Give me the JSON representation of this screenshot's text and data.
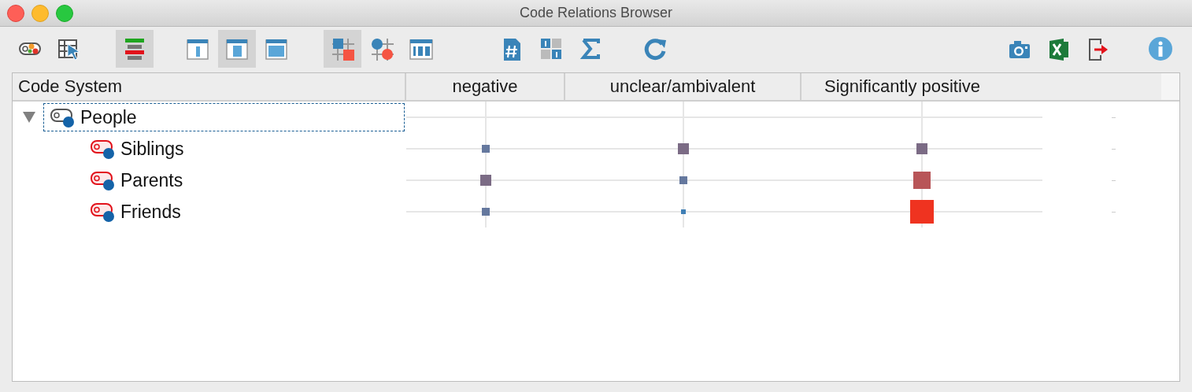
{
  "window": {
    "title": "Code Relations Browser"
  },
  "toolbar": [
    {
      "selected": false
    },
    {
      "selected": false
    },
    {
      "selected": true
    },
    {
      "selected": false
    },
    {
      "selected": true
    },
    {
      "selected": false
    },
    {
      "selected": true
    },
    {
      "selected": false
    },
    {
      "selected": false
    },
    {
      "selected": false
    },
    {
      "selected": false
    },
    {
      "selected": false
    },
    {
      "selected": false
    },
    {
      "selected": false
    },
    {
      "selected": false
    },
    {
      "selected": false
    },
    {
      "selected": false
    }
  ],
  "table": {
    "columns": [
      "Code System",
      "negative",
      "unclear/ambivalent",
      "Significantly positive"
    ],
    "tree": [
      {
        "name": "People",
        "kind": "group",
        "expanded": true,
        "focused": true,
        "children": [
          {
            "name": "Siblings",
            "kind": "code",
            "cells": [
              {
                "kind": "small",
                "color": "#65789e"
              },
              {
                "kind": "medium",
                "color": "#7b6b85"
              },
              {
                "kind": "medium",
                "color": "#7b6b85"
              }
            ]
          },
          {
            "name": "Parents",
            "kind": "code",
            "cells": [
              {
                "kind": "medium",
                "color": "#7b6b85"
              },
              {
                "kind": "small",
                "color": "#65789e"
              },
              {
                "kind": "large",
                "color": "#b85558"
              }
            ]
          },
          {
            "name": "Friends",
            "kind": "code",
            "cells": [
              {
                "kind": "small",
                "color": "#65789e"
              },
              {
                "kind": "tiny",
                "color": "#3f7fb5"
              },
              {
                "kind": "xlarge",
                "color": "#ef3320"
              }
            ]
          }
        ]
      }
    ]
  }
}
